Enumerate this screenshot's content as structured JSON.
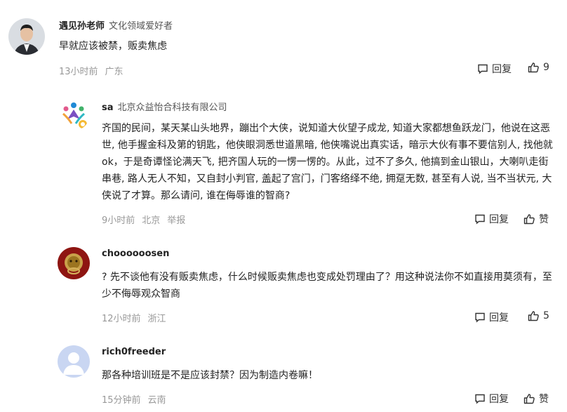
{
  "comments": [
    {
      "name": "遇见孙老师",
      "tag": "文化领域爱好者",
      "text": "早就应该被禁，贩卖焦虑",
      "time": "13小时前",
      "location": "广东",
      "report": "",
      "reply_label": "回复",
      "like_label": "9"
    },
    {
      "name": "sa",
      "tag": "北京众益怡合科技有限公司",
      "text": "齐国的民间，某天某山头地界，蹦出个大侠，说知道大伙望子成龙, 知道大家都想鱼跃龙门，他说在这恶世, 他手握金科及第的钥匙，他侠眼洞悉世道黑暗, 他侠嘴说出真实话，暗示大伙有事不要信别人, 找他就ok，于是奇谭怪论满天飞, 把齐国人玩的一愣一愣的。从此，过不了多久, 他搞到金山银山，大喇叭走街串巷, 路人无人不知，又自封小判官, 盖起了宫门，门客络绎不绝, 拥趸无数, 甚至有人说, 当不当状元, 大侠说了才算。那么请问, 谁在侮辱谁的智商?",
      "time": "9小时前",
      "location": "北京",
      "report": "举报",
      "reply_label": "回复",
      "like_label": "赞"
    },
    {
      "name": "choooooosen",
      "tag": "",
      "text": "? 先不谈他有没有贩卖焦虑，什么时候贩卖焦虑也变成处罚理由了？用这种说法你不如直接用莫须有，至少不侮辱观众智商",
      "time": "12小时前",
      "location": "浙江",
      "report": "",
      "reply_label": "回复",
      "like_label": "5"
    },
    {
      "name": "rich0freeder",
      "tag": "",
      "text": "那各种培训班是不是应该封禁？因为制造内卷嘛！",
      "time": "15分钟前",
      "location": "云南",
      "report": "",
      "reply_label": "回复",
      "like_label": "赞"
    }
  ]
}
